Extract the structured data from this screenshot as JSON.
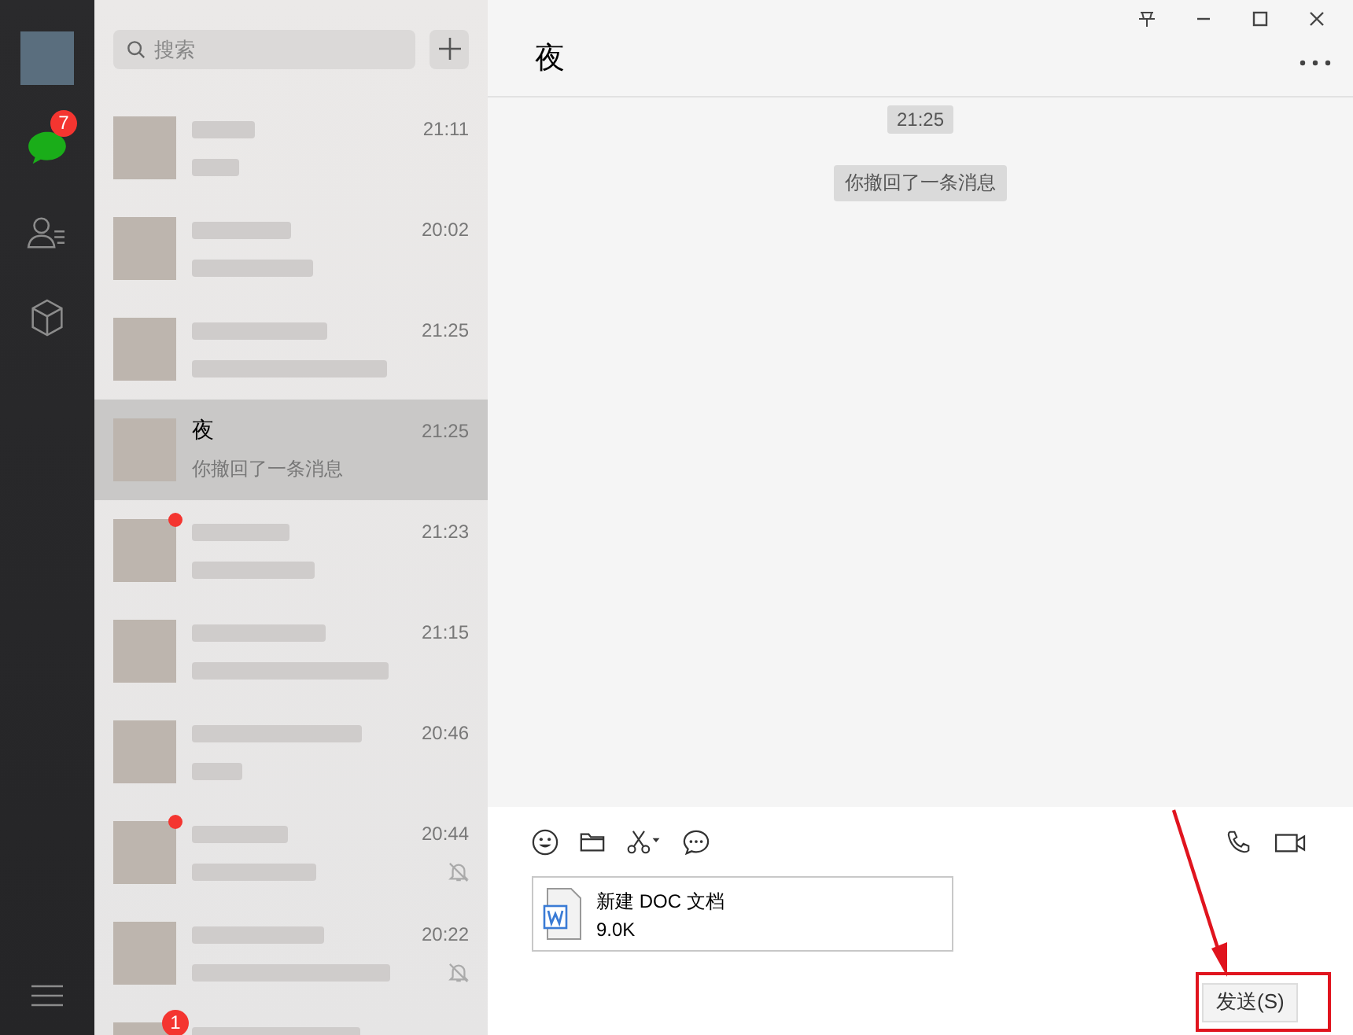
{
  "nav": {
    "chat_badge": "7",
    "items": [
      {
        "kind": "chat",
        "selected": true
      },
      {
        "kind": "contacts",
        "selected": false
      },
      {
        "kind": "box",
        "selected": false
      }
    ]
  },
  "search": {
    "placeholder": "搜索"
  },
  "chats": [
    {
      "kind": "blurred",
      "time": "21:11",
      "selected": false,
      "unread_dot": false,
      "muted": false
    },
    {
      "kind": "blurred",
      "time": "20:02",
      "selected": false,
      "unread_dot": false,
      "muted": false
    },
    {
      "kind": "blurred",
      "time": "21:25",
      "selected": false,
      "unread_dot": false,
      "muted": false
    },
    {
      "kind": "plain",
      "name": "夜",
      "preview": "你撤回了一条消息",
      "time": "21:25",
      "selected": true,
      "unread_dot": false,
      "muted": false
    },
    {
      "kind": "blurred",
      "time": "21:23",
      "selected": false,
      "unread_dot": true,
      "muted": false
    },
    {
      "kind": "blurred",
      "time": "21:15",
      "selected": false,
      "unread_dot": false,
      "muted": false
    },
    {
      "kind": "blurred",
      "time": "20:46",
      "selected": false,
      "unread_dot": false,
      "muted": false
    },
    {
      "kind": "blurred",
      "time": "20:44",
      "selected": false,
      "unread_dot": true,
      "muted": true
    },
    {
      "kind": "blurred",
      "time": "20:22",
      "selected": false,
      "unread_dot": false,
      "muted": true
    },
    {
      "kind": "blurred",
      "badge": "1",
      "selected": false,
      "unread_dot": false,
      "muted": false
    }
  ],
  "conversation": {
    "title": "夜",
    "messages": [
      {
        "kind": "time",
        "text": "21:25"
      },
      {
        "kind": "system",
        "text": "你撤回了一条消息"
      }
    ]
  },
  "composer": {
    "attachment": {
      "name": "新建 DOC 文档",
      "size": "9.0K"
    },
    "send_button": "发送(S)"
  }
}
